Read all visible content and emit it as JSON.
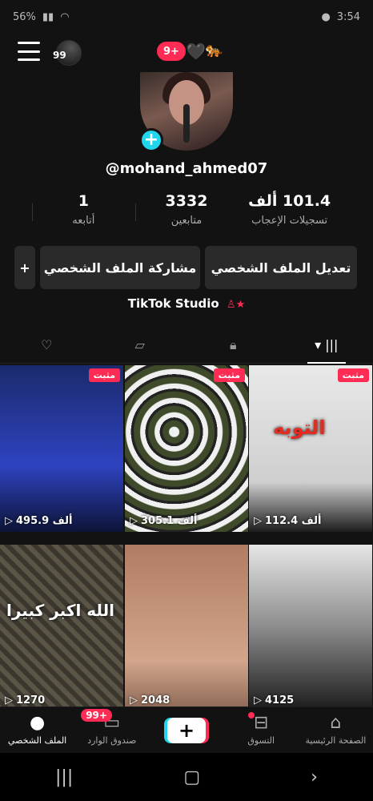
{
  "statusbar": {
    "left": "56%",
    "right": "3:54"
  },
  "topbar": {
    "avatar_label": "99",
    "notif_count": "9+",
    "heart": "🖤",
    "tiger": "🐅"
  },
  "profile": {
    "username": "@mohand_ahmed07",
    "stats": [
      {
        "value": "101.4 ألف",
        "label": "تسجيلات الإعجاب"
      },
      {
        "value": "3332",
        "label": "متابعين"
      },
      {
        "value": "1",
        "label": "أتابعه"
      }
    ],
    "edit_label": "تعديل الملف الشخصي",
    "share_label": "مشاركة الملف الشخصي",
    "studio_label": "TikTok Studio"
  },
  "videos": [
    {
      "pinned": "مثبت",
      "views": "112.4 ألف",
      "caption": "التوبه"
    },
    {
      "pinned": "مثبت",
      "views": "305.1 ألف",
      "caption": ""
    },
    {
      "pinned": "مثبت",
      "views": "495.9 ألف",
      "caption": ""
    },
    {
      "pinned": "",
      "views": "4125",
      "caption": ""
    },
    {
      "pinned": "",
      "views": "2048",
      "caption": ""
    },
    {
      "pinned": "",
      "views": "1270",
      "caption": "الله اكبر كبيرا"
    }
  ],
  "bottom_nav": {
    "home": "الصفحة الرئيسية",
    "shop": "التسوق",
    "inbox": "صندوق الوارد",
    "inbox_badge": "+99",
    "profile": "الملف الشخصي"
  }
}
